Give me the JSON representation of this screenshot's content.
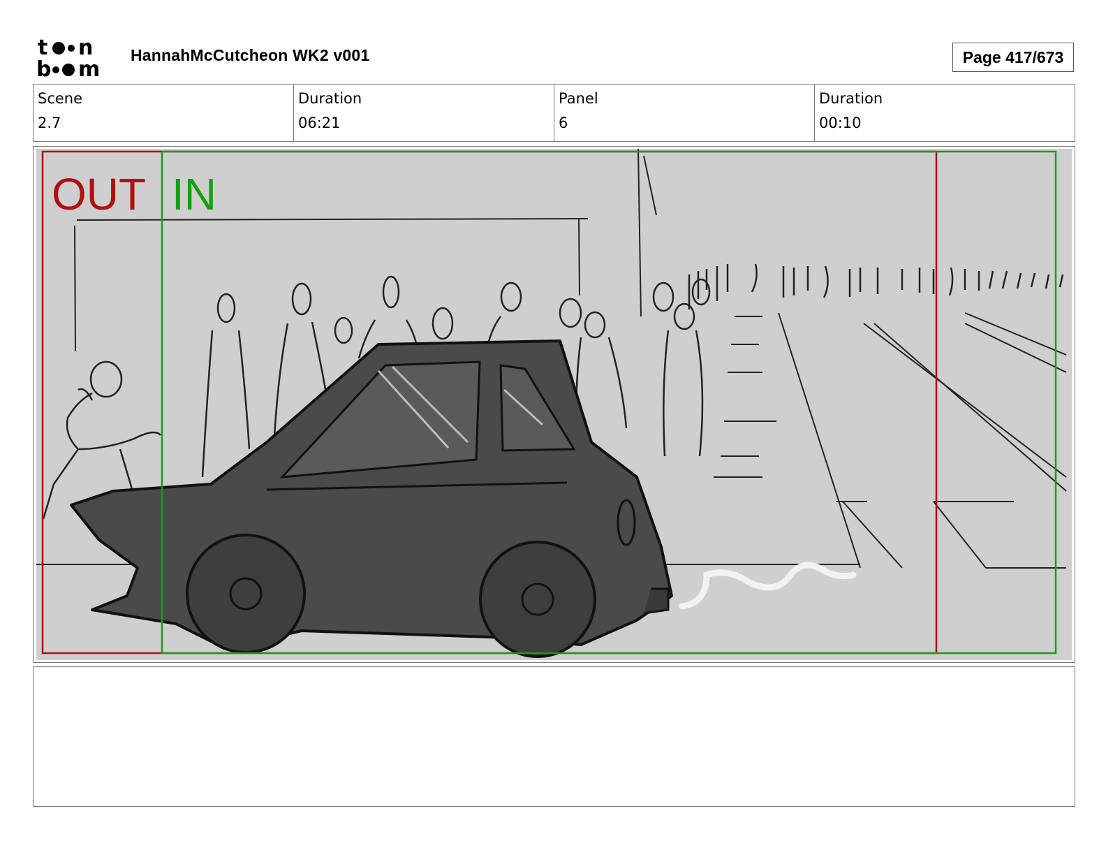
{
  "header": {
    "logo": {
      "name": "toon-boom-logo",
      "line1": "toon",
      "line2": "boom"
    },
    "title": "HannahMcCutcheon WK2 v001",
    "page": "Page 417/673"
  },
  "info": [
    {
      "label": "Scene",
      "value": "2.7"
    },
    {
      "label": "Duration",
      "value": "06:21"
    },
    {
      "label": "Panel",
      "value": "6"
    },
    {
      "label": "Duration",
      "value": "00:10"
    }
  ],
  "panel": {
    "out_label": "OUT",
    "in_label": "IN",
    "colors": {
      "out": "#b01010",
      "in": "#14a014",
      "bg": "#cfcfcf",
      "car": "#4a4a4a"
    }
  },
  "notes": ""
}
